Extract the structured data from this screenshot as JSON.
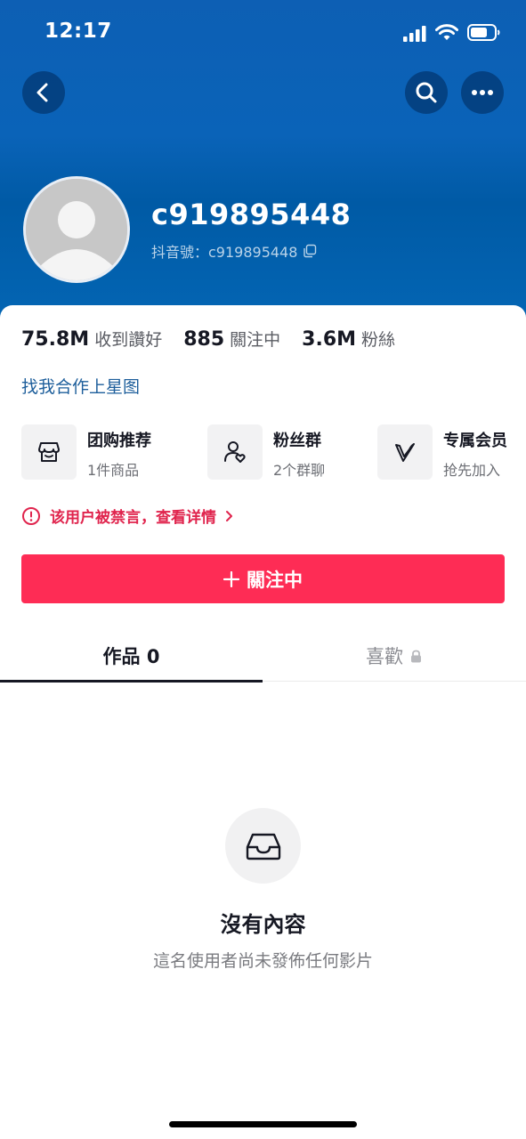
{
  "status_bar": {
    "time": "12:17",
    "icons": [
      "cellular-signal-icon",
      "wifi-icon",
      "battery-icon"
    ]
  },
  "nav": {
    "back_icon": "chevron-left-icon",
    "search_icon": "search-icon",
    "more_icon": "more-horizontal-icon"
  },
  "profile": {
    "username": "c919895448",
    "douyin_id": "抖音號：c919895448",
    "copy_icon": "copy-icon"
  },
  "stats": [
    {
      "value": "75.8M",
      "label": "收到讚好"
    },
    {
      "value": "885",
      "label": "關注中"
    },
    {
      "value": "3.6M",
      "label": "粉絲"
    }
  ],
  "star_link": "找我合作上星图",
  "features": [
    {
      "title": "团购推荐",
      "subtitle": "1件商品",
      "icon": "store-icon"
    },
    {
      "title": "粉丝群",
      "subtitle": "2个群聊",
      "icon": "user-heart-icon"
    },
    {
      "title": "专属会员",
      "subtitle": "抢先加入",
      "icon": "v-member-icon"
    }
  ],
  "ban_notice": "该用户被禁言，查看详情",
  "follow_button": {
    "label": "關注中",
    "icon": "plus-icon"
  },
  "tabs": [
    {
      "label": "作品 0",
      "active": true
    },
    {
      "label": "喜歡",
      "locked": true
    }
  ],
  "empty_state": {
    "title": "沒有內容",
    "subtitle": "這名使用者尚未發佈任何影片",
    "icon": "inbox-icon"
  },
  "colors": {
    "header_blue": "#0a63b8",
    "accent_red": "#fe2c55",
    "link_blue": "#1d5e9b",
    "warning_red": "#e0244d"
  }
}
